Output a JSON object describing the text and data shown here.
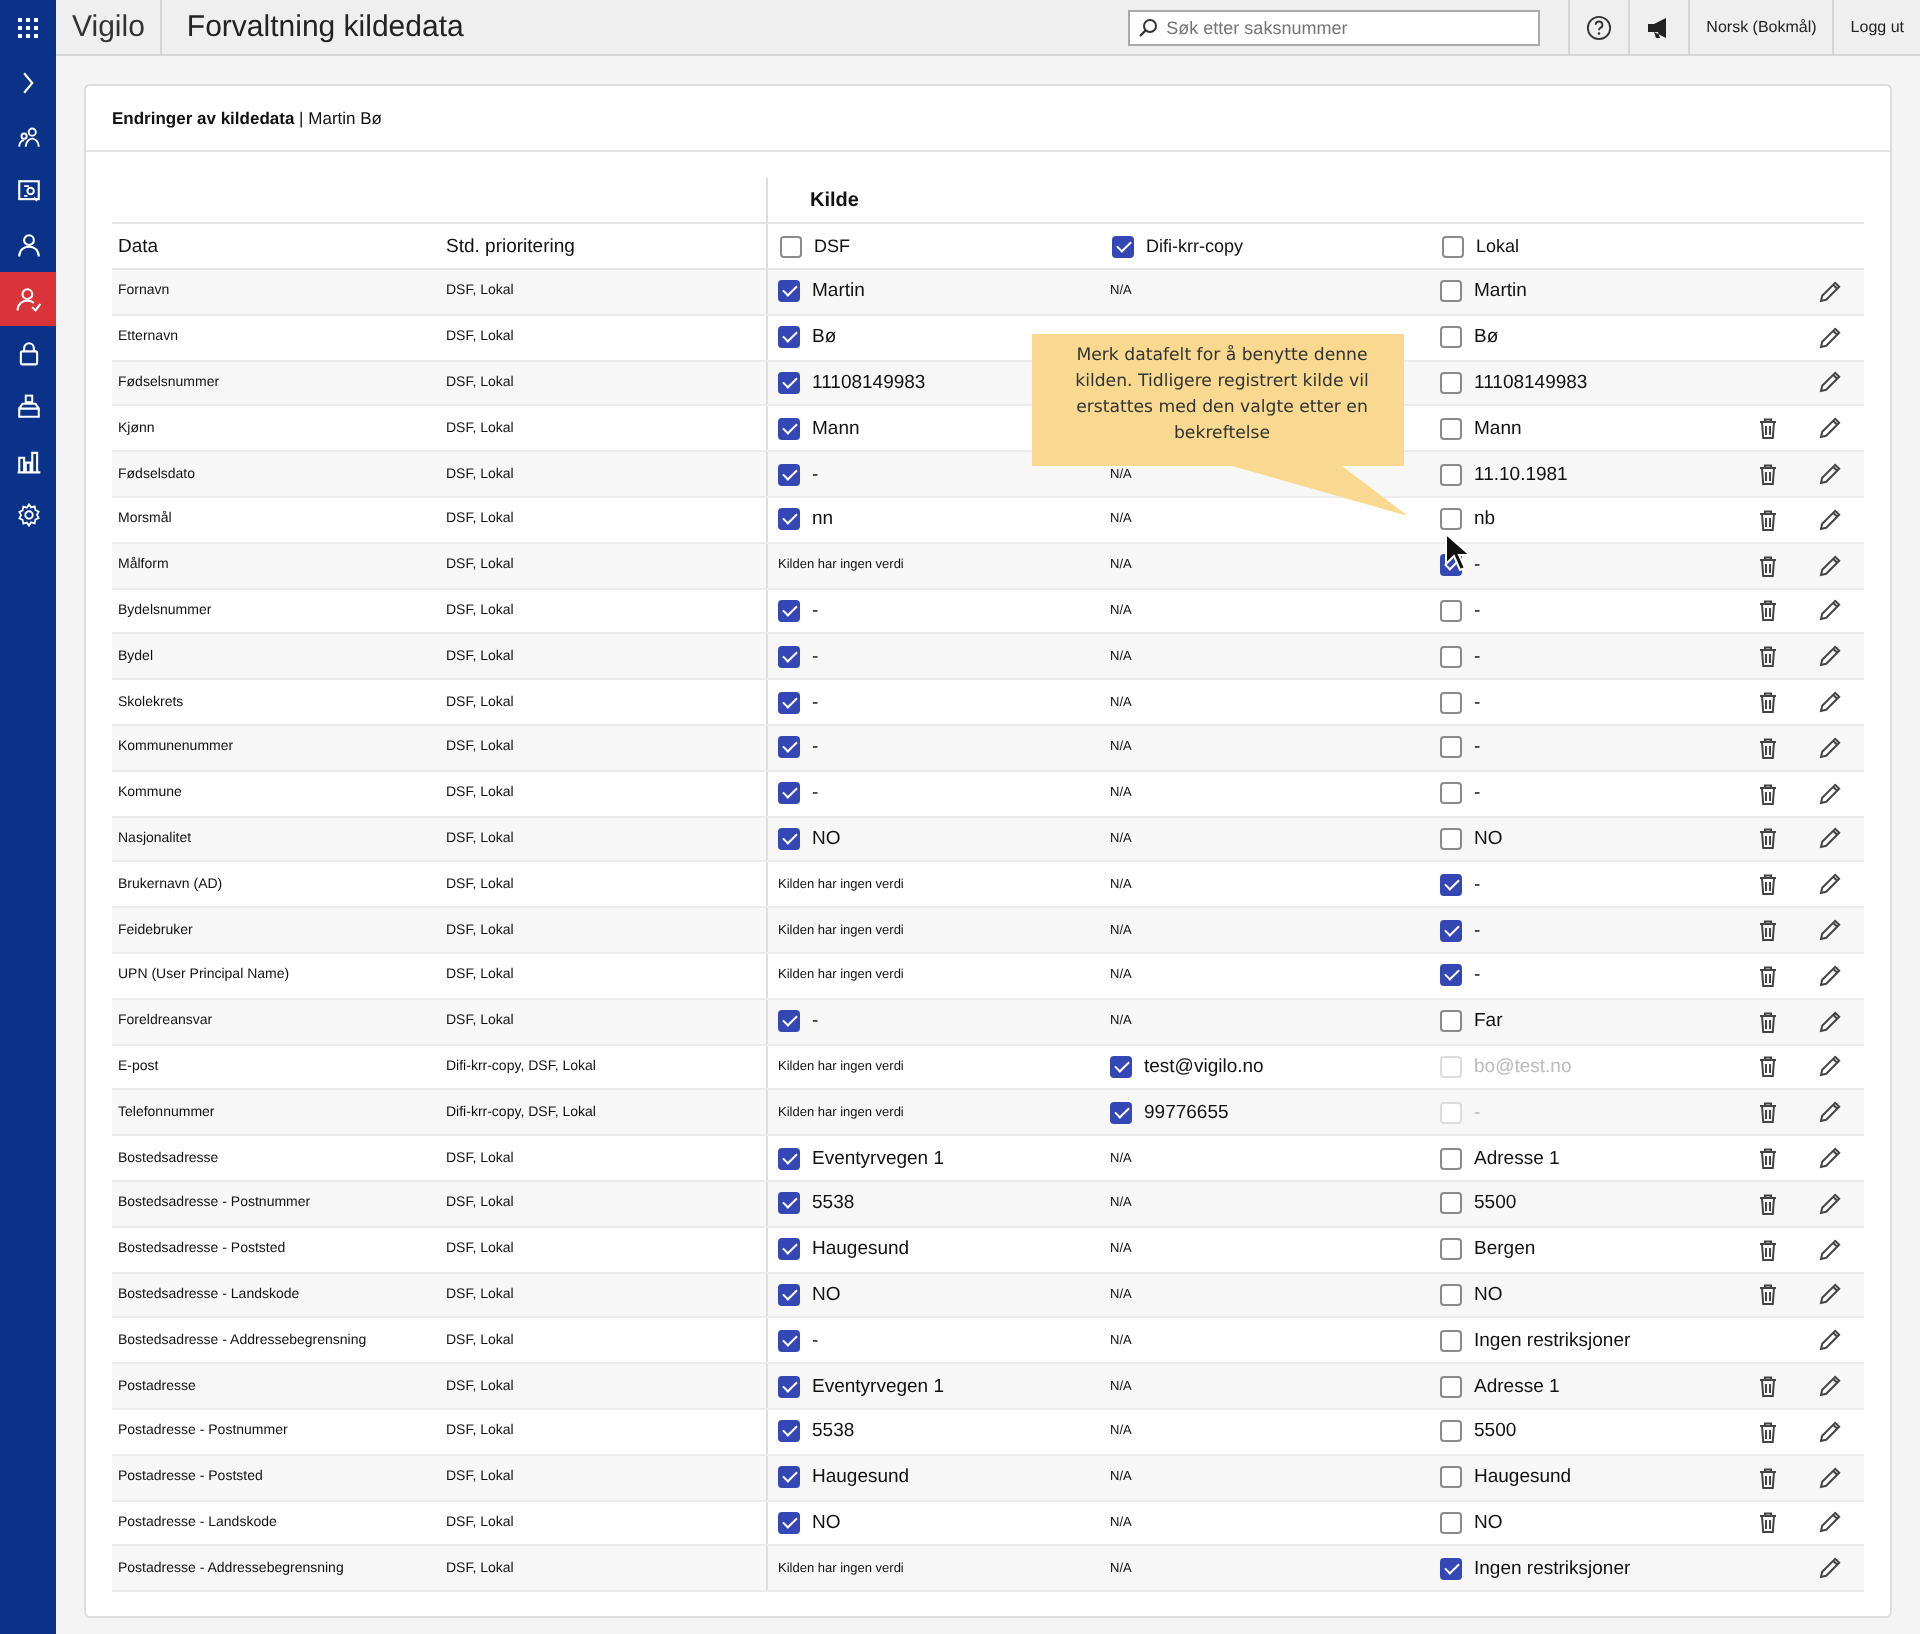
{
  "topbar": {
    "brand": "Vigilo",
    "title": "Forvaltning kildedata",
    "search": {
      "placeholder": "Søk etter saksnummer"
    },
    "language": "Norsk (Bokmål)",
    "logout": "Logg ut"
  },
  "sidebar": {
    "items": [
      {
        "kind": "chevron",
        "selected": false
      },
      {
        "kind": "people",
        "selected": false
      },
      {
        "kind": "board",
        "selected": false
      },
      {
        "kind": "person",
        "selected": false
      },
      {
        "kind": "person-check",
        "selected": true
      },
      {
        "kind": "lock",
        "selected": false
      },
      {
        "kind": "tray",
        "selected": false
      },
      {
        "kind": "chart",
        "selected": false
      },
      {
        "kind": "gear",
        "selected": false
      }
    ]
  },
  "card": {
    "title": "Endringer av kildedata",
    "separator": "|",
    "subtitle": "Martin Bø"
  },
  "table": {
    "group_label": "Kilde",
    "columns": [
      "Data",
      "Std. prioritering"
    ],
    "sources": [
      {
        "label": "DSF",
        "checked": false
      },
      {
        "label": "Difi-krr-copy",
        "checked": true
      },
      {
        "label": "Lokal",
        "checked": false
      }
    ],
    "rows": [
      {
        "label": "Fornavn",
        "priority": "DSF, Lokal",
        "dsf": {
          "kind": "check",
          "checked": true,
          "value": "Martin"
        },
        "difi": {
          "kind": "text",
          "text": "N/A"
        },
        "lokal": {
          "kind": "check",
          "checked": false,
          "value": "Martin"
        },
        "delete": false
      },
      {
        "label": "Etternavn",
        "priority": "DSF, Lokal",
        "dsf": {
          "kind": "check",
          "checked": true,
          "value": "Bø"
        },
        "lokal": {
          "kind": "check",
          "checked": false,
          "value": "Bø"
        },
        "delete": false
      },
      {
        "label": "Fødselsnummer",
        "priority": "DSF, Lokal",
        "dsf": {
          "kind": "check",
          "checked": true,
          "value": "11108149983"
        },
        "lokal": {
          "kind": "check",
          "checked": false,
          "value": "11108149983"
        },
        "delete": false
      },
      {
        "label": "Kjønn",
        "priority": "DSF, Lokal",
        "dsf": {
          "kind": "check",
          "checked": true,
          "value": "Mann"
        },
        "lokal": {
          "kind": "check",
          "checked": false,
          "value": "Mann"
        },
        "delete": true
      },
      {
        "label": "Fødselsdato",
        "priority": "DSF, Lokal",
        "dsf": {
          "kind": "check",
          "checked": true,
          "value": "-"
        },
        "difi": {
          "kind": "text",
          "text": "N/A"
        },
        "lokal": {
          "kind": "check",
          "checked": false,
          "value": "11.10.1981"
        },
        "delete": true
      },
      {
        "label": "Morsmål",
        "priority": "DSF, Lokal",
        "dsf": {
          "kind": "check",
          "checked": true,
          "value": "nn"
        },
        "difi": {
          "kind": "text",
          "text": "N/A"
        },
        "lokal": {
          "kind": "check",
          "checked": false,
          "value": "nb"
        },
        "delete": true
      },
      {
        "label": "Målform",
        "priority": "DSF, Lokal",
        "dsf": {
          "kind": "text",
          "text": "Kilden har ingen verdi"
        },
        "difi": {
          "kind": "text",
          "text": "N/A"
        },
        "lokal": {
          "kind": "check",
          "checked": true,
          "value": "-"
        },
        "delete": true
      },
      {
        "label": "Bydelsnummer",
        "priority": "DSF, Lokal",
        "dsf": {
          "kind": "check",
          "checked": true,
          "value": "-"
        },
        "difi": {
          "kind": "text",
          "text": "N/A"
        },
        "lokal": {
          "kind": "check",
          "checked": false,
          "value": "-"
        },
        "delete": true
      },
      {
        "label": "Bydel",
        "priority": "DSF, Lokal",
        "dsf": {
          "kind": "check",
          "checked": true,
          "value": "-"
        },
        "difi": {
          "kind": "text",
          "text": "N/A"
        },
        "lokal": {
          "kind": "check",
          "checked": false,
          "value": "-"
        },
        "delete": true
      },
      {
        "label": "Skolekrets",
        "priority": "DSF, Lokal",
        "dsf": {
          "kind": "check",
          "checked": true,
          "value": "-"
        },
        "difi": {
          "kind": "text",
          "text": "N/A"
        },
        "lokal": {
          "kind": "check",
          "checked": false,
          "value": "-"
        },
        "delete": true
      },
      {
        "label": "Kommunenummer",
        "priority": "DSF, Lokal",
        "dsf": {
          "kind": "check",
          "checked": true,
          "value": "-"
        },
        "difi": {
          "kind": "text",
          "text": "N/A"
        },
        "lokal": {
          "kind": "check",
          "checked": false,
          "value": "-"
        },
        "delete": true
      },
      {
        "label": "Kommune",
        "priority": "DSF, Lokal",
        "dsf": {
          "kind": "check",
          "checked": true,
          "value": "-"
        },
        "difi": {
          "kind": "text",
          "text": "N/A"
        },
        "lokal": {
          "kind": "check",
          "checked": false,
          "value": "-"
        },
        "delete": true
      },
      {
        "label": "Nasjonalitet",
        "priority": "DSF, Lokal",
        "dsf": {
          "kind": "check",
          "checked": true,
          "value": "NO"
        },
        "difi": {
          "kind": "text",
          "text": "N/A"
        },
        "lokal": {
          "kind": "check",
          "checked": false,
          "value": "NO"
        },
        "delete": true
      },
      {
        "label": "Brukernavn (AD)",
        "priority": "DSF, Lokal",
        "dsf": {
          "kind": "text",
          "text": "Kilden har ingen verdi"
        },
        "difi": {
          "kind": "text",
          "text": "N/A"
        },
        "lokal": {
          "kind": "check",
          "checked": true,
          "value": "-"
        },
        "delete": true
      },
      {
        "label": "Feidebruker",
        "priority": "DSF, Lokal",
        "dsf": {
          "kind": "text",
          "text": "Kilden har ingen verdi"
        },
        "difi": {
          "kind": "text",
          "text": "N/A"
        },
        "lokal": {
          "kind": "check",
          "checked": true,
          "value": "-"
        },
        "delete": true
      },
      {
        "label": "UPN (User Principal Name)",
        "priority": "DSF, Lokal",
        "dsf": {
          "kind": "text",
          "text": "Kilden har ingen verdi"
        },
        "difi": {
          "kind": "text",
          "text": "N/A"
        },
        "lokal": {
          "kind": "check",
          "checked": true,
          "value": "-"
        },
        "delete": true
      },
      {
        "label": "Foreldreansvar",
        "priority": "DSF, Lokal",
        "dsf": {
          "kind": "check",
          "checked": true,
          "value": "-"
        },
        "difi": {
          "kind": "text",
          "text": "N/A"
        },
        "lokal": {
          "kind": "check",
          "checked": false,
          "value": "Far"
        },
        "delete": true
      },
      {
        "label": "E-post",
        "priority": "Difi-krr-copy, DSF, Lokal",
        "dsf": {
          "kind": "text",
          "text": "Kilden har ingen verdi"
        },
        "difi": {
          "kind": "check",
          "checked": true,
          "value": "test@vigilo.no"
        },
        "lokal": {
          "kind": "check",
          "checked": false,
          "disabled": true,
          "value": "bo@test.no"
        },
        "delete": true
      },
      {
        "label": "Telefonnummer",
        "priority": "Difi-krr-copy, DSF, Lokal",
        "dsf": {
          "kind": "text",
          "text": "Kilden har ingen verdi"
        },
        "difi": {
          "kind": "check",
          "checked": true,
          "value": "99776655"
        },
        "lokal": {
          "kind": "check",
          "checked": false,
          "disabled": true,
          "value": "-"
        },
        "delete": true
      },
      {
        "label": "Bostedsadresse",
        "priority": "DSF, Lokal",
        "dsf": {
          "kind": "check",
          "checked": true,
          "value": "Eventyrvegen 1"
        },
        "difi": {
          "kind": "text",
          "text": "N/A"
        },
        "lokal": {
          "kind": "check",
          "checked": false,
          "value": "Adresse 1"
        },
        "delete": true
      },
      {
        "label": "Bostedsadresse - Postnummer",
        "priority": "DSF, Lokal",
        "dsf": {
          "kind": "check",
          "checked": true,
          "value": "5538"
        },
        "difi": {
          "kind": "text",
          "text": "N/A"
        },
        "lokal": {
          "kind": "check",
          "checked": false,
          "value": "5500"
        },
        "delete": true
      },
      {
        "label": "Bostedsadresse - Poststed",
        "priority": "DSF, Lokal",
        "dsf": {
          "kind": "check",
          "checked": true,
          "value": "Haugesund"
        },
        "difi": {
          "kind": "text",
          "text": "N/A"
        },
        "lokal": {
          "kind": "check",
          "checked": false,
          "value": "Bergen"
        },
        "delete": true
      },
      {
        "label": "Bostedsadresse - Landskode",
        "priority": "DSF, Lokal",
        "dsf": {
          "kind": "check",
          "checked": true,
          "value": "NO"
        },
        "difi": {
          "kind": "text",
          "text": "N/A"
        },
        "lokal": {
          "kind": "check",
          "checked": false,
          "value": "NO"
        },
        "delete": true
      },
      {
        "label": "Bostedsadresse - Addressebegrensning",
        "priority": "DSF, Lokal",
        "dsf": {
          "kind": "check",
          "checked": true,
          "value": "-"
        },
        "difi": {
          "kind": "text",
          "text": "N/A"
        },
        "lokal": {
          "kind": "check",
          "checked": false,
          "value": "Ingen restriksjoner"
        },
        "delete": false
      },
      {
        "label": "Postadresse",
        "priority": "DSF, Lokal",
        "dsf": {
          "kind": "check",
          "checked": true,
          "value": "Eventyrvegen 1"
        },
        "difi": {
          "kind": "text",
          "text": "N/A"
        },
        "lokal": {
          "kind": "check",
          "checked": false,
          "value": "Adresse 1"
        },
        "delete": true
      },
      {
        "label": "Postadresse - Postnummer",
        "priority": "DSF, Lokal",
        "dsf": {
          "kind": "check",
          "checked": true,
          "value": "5538"
        },
        "difi": {
          "kind": "text",
          "text": "N/A"
        },
        "lokal": {
          "kind": "check",
          "checked": false,
          "value": "5500"
        },
        "delete": true
      },
      {
        "label": "Postadresse - Poststed",
        "priority": "DSF, Lokal",
        "dsf": {
          "kind": "check",
          "checked": true,
          "value": "Haugesund"
        },
        "difi": {
          "kind": "text",
          "text": "N/A"
        },
        "lokal": {
          "kind": "check",
          "checked": false,
          "value": "Haugesund"
        },
        "delete": true
      },
      {
        "label": "Postadresse - Landskode",
        "priority": "DSF, Lokal",
        "dsf": {
          "kind": "check",
          "checked": true,
          "value": "NO"
        },
        "difi": {
          "kind": "text",
          "text": "N/A"
        },
        "lokal": {
          "kind": "check",
          "checked": false,
          "value": "NO"
        },
        "delete": true
      },
      {
        "label": "Postadresse - Addressebegrensning",
        "priority": "DSF, Lokal",
        "dsf": {
          "kind": "text",
          "text": "Kilden har ingen verdi"
        },
        "difi": {
          "kind": "text",
          "text": "N/A"
        },
        "lokal": {
          "kind": "check",
          "checked": true,
          "value": "Ingen restriksjoner"
        },
        "delete": false
      }
    ]
  },
  "tooltip": {
    "text": "Merk datafelt for å benytte denne kilden. Tidligere registrert kilde vil erstattes med den valgte etter en bekreftelse"
  }
}
